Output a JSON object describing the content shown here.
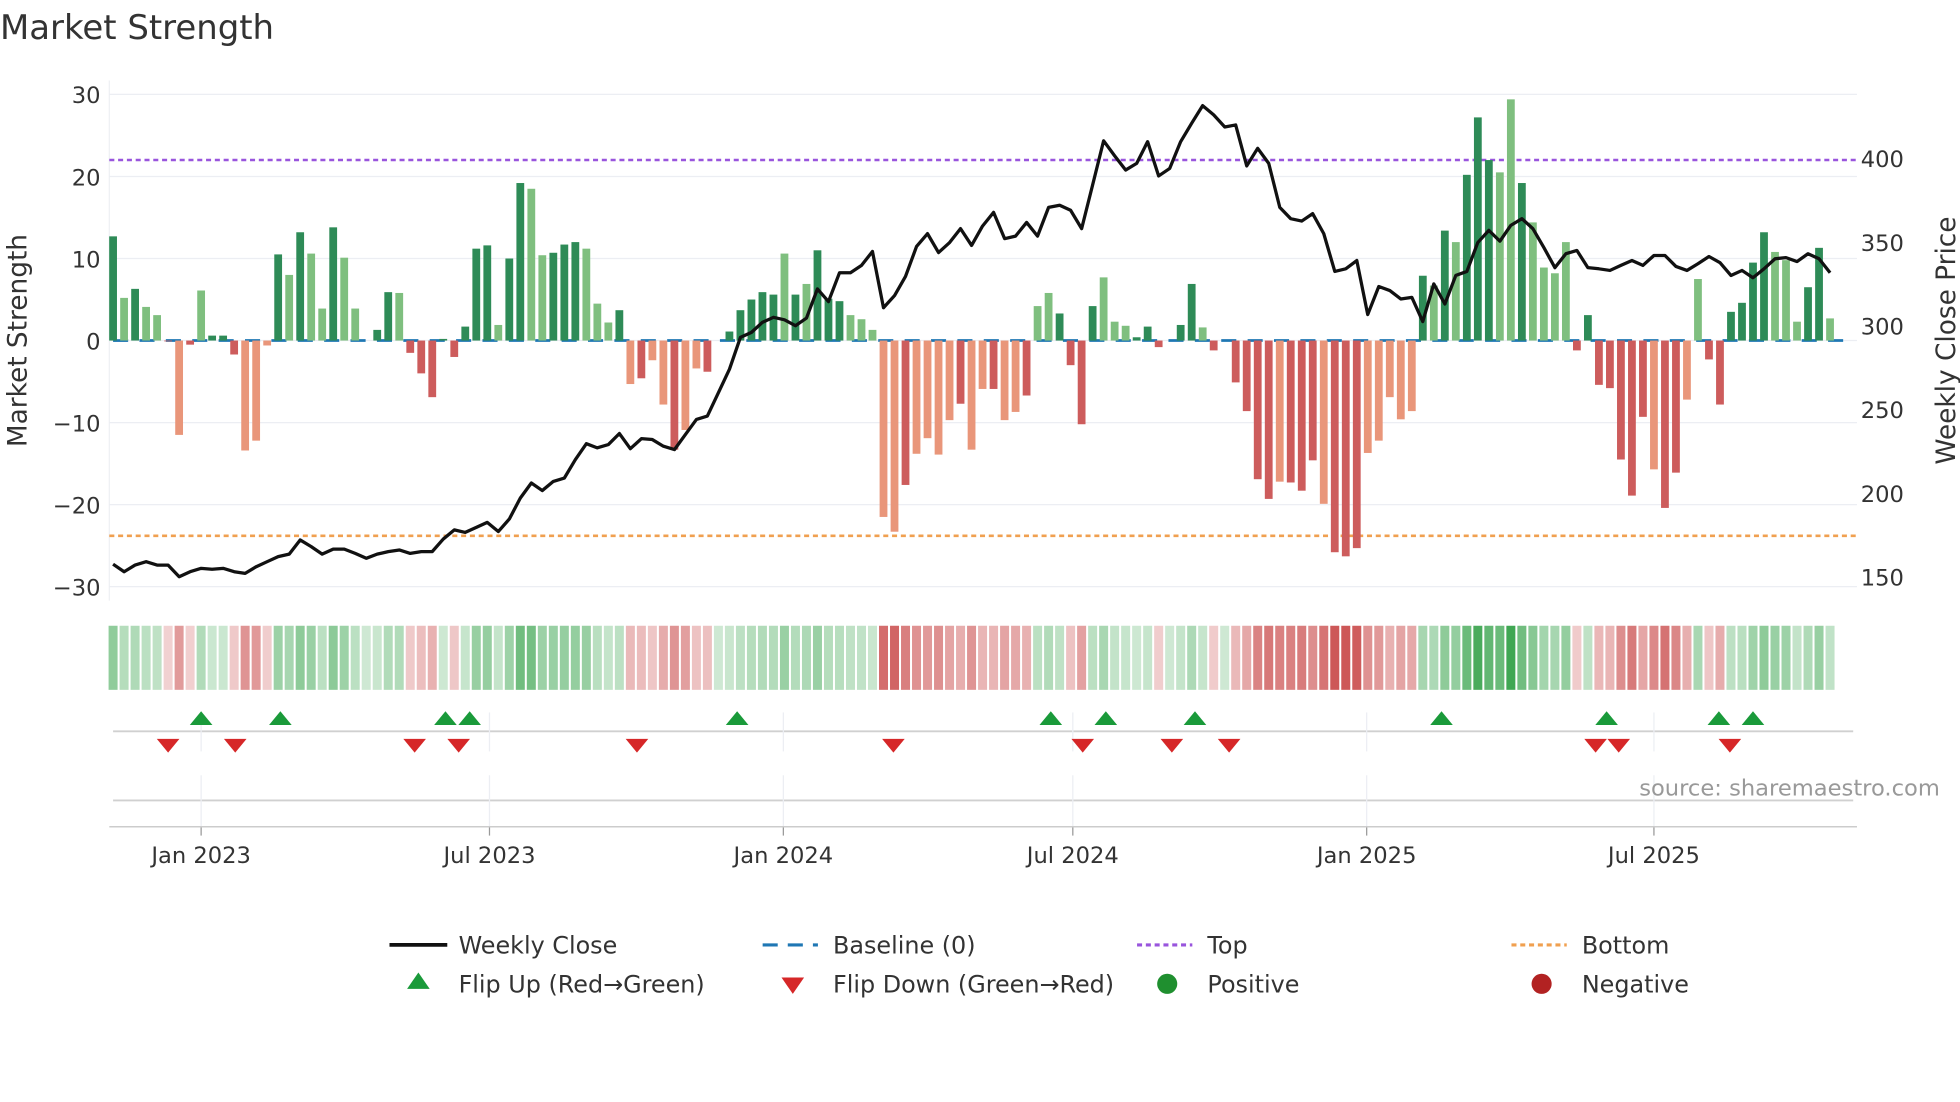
{
  "chart_data": {
    "type": "bar",
    "title": "Market Strength",
    "ylabel": "Market Strength",
    "y2label": "Weekly Close Price",
    "ylim": [
      -31.5,
      31
    ],
    "y2lim": [
      142,
      437
    ],
    "yticks": [
      "30",
      "20",
      "10",
      "0",
      "−10",
      "−20",
      "−30"
    ],
    "ytick_values": [
      30,
      20,
      10,
      0,
      -10,
      -20,
      -30
    ],
    "y2ticks": [
      "400",
      "350",
      "300",
      "250",
      "200",
      "150"
    ],
    "y2tick_values": [
      400,
      350,
      300,
      250,
      200,
      150
    ],
    "xticks": [
      "Jan 2023",
      "Jul 2023",
      "Jan 2024",
      "Jul 2024",
      "Jan 2025",
      "Jul 2025"
    ],
    "xtick_weeks": [
      8,
      34.2,
      60.9,
      87.2,
      113.9,
      140
    ],
    "grid": true,
    "top_level": 22,
    "bottom_level": -23.8,
    "baseline": 0,
    "strength": [
      12.7,
      5.2,
      6.3,
      4.1,
      3.1,
      -0.1,
      -11.5,
      -0.5,
      6.1,
      0.6,
      0.6,
      -1.7,
      -13.4,
      -12.2,
      -0.6,
      10.5,
      8.0,
      13.2,
      10.6,
      3.9,
      13.8,
      10.1,
      3.9,
      0,
      1.3,
      5.9,
      5.8,
      -1.5,
      -4.0,
      -6.9,
      0.2,
      -2.0,
      1.7,
      11.2,
      11.6,
      1.9,
      10.0,
      19.2,
      18.5,
      10.4,
      10.7,
      11.7,
      12.0,
      11.2,
      4.5,
      2.2,
      3.7,
      -5.3,
      -4.6,
      -2.4,
      -7.8,
      -13.3,
      -10.9,
      -3.4,
      -3.8,
      0,
      1.1,
      3.7,
      5.0,
      5.9,
      5.6,
      10.6,
      5.6,
      6.9,
      11.0,
      5.1,
      4.8,
      3.1,
      2.6,
      1.3,
      -21.5,
      -23.3,
      -17.6,
      -13.8,
      -11.9,
      -13.9,
      -9.7,
      -7.7,
      -13.3,
      -5.9,
      -5.9,
      -9.7,
      -8.7,
      -6.7,
      4.2,
      5.8,
      3.3,
      -3.0,
      -10.2,
      4.2,
      7.7,
      2.3,
      1.8,
      0.4,
      1.7,
      -0.8,
      0,
      1.9,
      6.9,
      1.6,
      -1.2,
      0,
      -5.1,
      -8.6,
      -16.9,
      -19.3,
      -17.2,
      -17.3,
      -18.3,
      -14.6,
      -19.9,
      -25.8,
      -26.3,
      -25.3,
      -13.7,
      -12.2,
      -6.9,
      -9.6,
      -8.6,
      7.9,
      6.7,
      13.4,
      12.0,
      20.2,
      27.2,
      22.0,
      20.5,
      29.4,
      19.2,
      14.4,
      8.9,
      8.2,
      12.0,
      -1.2,
      3.1,
      -5.4,
      -5.8,
      -14.5,
      -18.9,
      -9.3,
      -15.7,
      -20.4,
      -16.1,
      -7.2,
      7.5,
      -2.3,
      -7.8,
      3.5,
      4.6,
      9.5,
      13.2,
      10.8,
      9.8,
      2.3,
      6.5,
      11.3,
      2.7
    ],
    "shade": "dldlldldldddllldldlldlldddlddddddddlddlldddllldldlldlldddddddldldddllllldlllldlldlldllddddlllddddddlddddddldddldddllllldldldddlldlllldddddddlddllddddddlllddl",
    "weekly_close": [
      157.5,
      153,
      157,
      159,
      157,
      157,
      150,
      153,
      155,
      154.5,
      155,
      153,
      152,
      156,
      159,
      162,
      163.5,
      172,
      168,
      163.5,
      166.5,
      166.5,
      164,
      161,
      163.5,
      165,
      166,
      164,
      165,
      165,
      172.5,
      178,
      176.5,
      179.5,
      182.5,
      177,
      184.5,
      197,
      206,
      201.5,
      207,
      209,
      220,
      229.5,
      227,
      229,
      235.6,
      226.5,
      232.5,
      232,
      228,
      226,
      235,
      244,
      246,
      260,
      274,
      293,
      296,
      302,
      305,
      303.5,
      300,
      304.6,
      322,
      314.4,
      331.7,
      331.7,
      336,
      344.4,
      310.7,
      318,
      329.4,
      347.4,
      355,
      343.7,
      349.7,
      358,
      348,
      359.5,
      367.7,
      352,
      353.5,
      361.7,
      353.5,
      370.7,
      372,
      369,
      358,
      384,
      410.5,
      401.5,
      393,
      397,
      410,
      389.5,
      394,
      410,
      421,
      431.5,
      426,
      418.8,
      420,
      395.5,
      406,
      397,
      370.7,
      364,
      362.5,
      367,
      355,
      332.4,
      334,
      339,
      306.7,
      323.4,
      321,
      316,
      317,
      302.5,
      325,
      313,
      330,
      332.4,
      349.7,
      357,
      350.5,
      360,
      364,
      358,
      346.7,
      334.7,
      343,
      345,
      334.7,
      334,
      333,
      336,
      339,
      336,
      342,
      342,
      335.4,
      333,
      337,
      341.4,
      337.7,
      330,
      333,
      328.7,
      334,
      340,
      340.7,
      338.4,
      343,
      340,
      331.7
    ],
    "flip_up_weeks": [
      8,
      15.2,
      30.2,
      32.4,
      56.7,
      85.2,
      90.2,
      98.3,
      120.7,
      135.7,
      145.9,
      149
    ],
    "flip_down_weeks": [
      5,
      11.1,
      27.4,
      31.4,
      47.6,
      70.9,
      88.1,
      96.2,
      101.4,
      134.7,
      136.8,
      146.9
    ],
    "legend": {
      "weekly_close": "Weekly Close",
      "baseline": "Baseline (0)",
      "top": "Top",
      "bottom": "Bottom",
      "flip_up": "Flip Up (Red→Green)",
      "flip_down": "Flip Down (Green→Red)",
      "positive": "Positive",
      "negative": "Negative"
    },
    "legend_position": "bottom-center",
    "source": "source: sharemaestro.com",
    "colors": {
      "pos_strong": "#2e8b57",
      "pos_weak": "#7fbf7f",
      "neg_strong": "#cd5c5c",
      "neg_weak": "#e9967a",
      "price": "#111111",
      "baseline": "#1f77b4",
      "top": "#9955dd",
      "bottom": "#f0a050",
      "flip_up": "#1a9a3a",
      "flip_down": "#d62728",
      "positive": "#1f8f2f",
      "negative": "#b22222"
    }
  }
}
